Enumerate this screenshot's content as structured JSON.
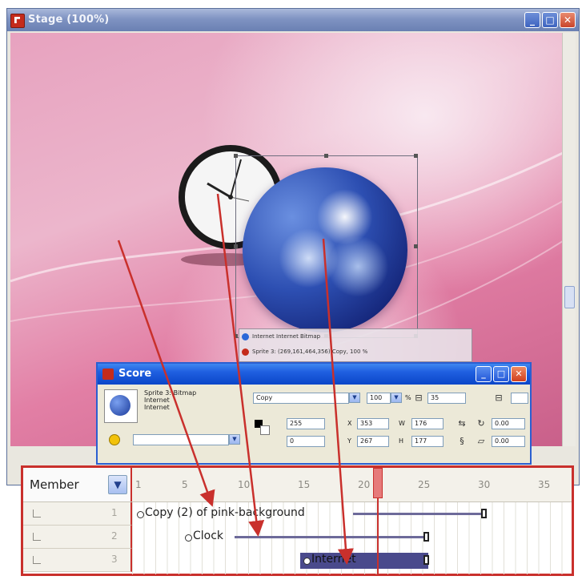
{
  "stage_window": {
    "title": "Stage (100%)",
    "sprite_tooltip": {
      "line1": "Internet  Internet  Bitmap",
      "line2": "Sprite 3: (269,161,464,356) Copy, 100 %"
    }
  },
  "score_window": {
    "title": "Score",
    "sprite_info": {
      "line1": "Sprite 3: Bitmap",
      "line2": "Internet",
      "line3": "Internet"
    },
    "ink_value": "Copy",
    "blend_value": "100",
    "blend_unit": "%",
    "frame_start": "35",
    "fg_value": "255",
    "bg_value": "0",
    "x_label": "X",
    "x_value": "353",
    "y_label": "Y",
    "y_value": "267",
    "w_label": "W",
    "w_value": "176",
    "h_label": "H",
    "h_value": "177",
    "rot_value": "0.00",
    "skew_value": "0.00"
  },
  "score_grid": {
    "member_label": "Member",
    "frame_numbers": [
      "1",
      "5",
      "10",
      "15",
      "20",
      "25",
      "30",
      "35"
    ],
    "channels": [
      {
        "number": "1",
        "sprite_label": "Copy (2) of pink-background"
      },
      {
        "number": "2",
        "sprite_label": "Clock"
      },
      {
        "number": "3",
        "sprite_label": "Internet"
      }
    ]
  },
  "colors": {
    "stage_title_bar": "#7f93c2",
    "score_title_bar": "#1f5fe0",
    "annotation_red": "#c9302c",
    "selected_sprite": "#4a4a8c"
  }
}
